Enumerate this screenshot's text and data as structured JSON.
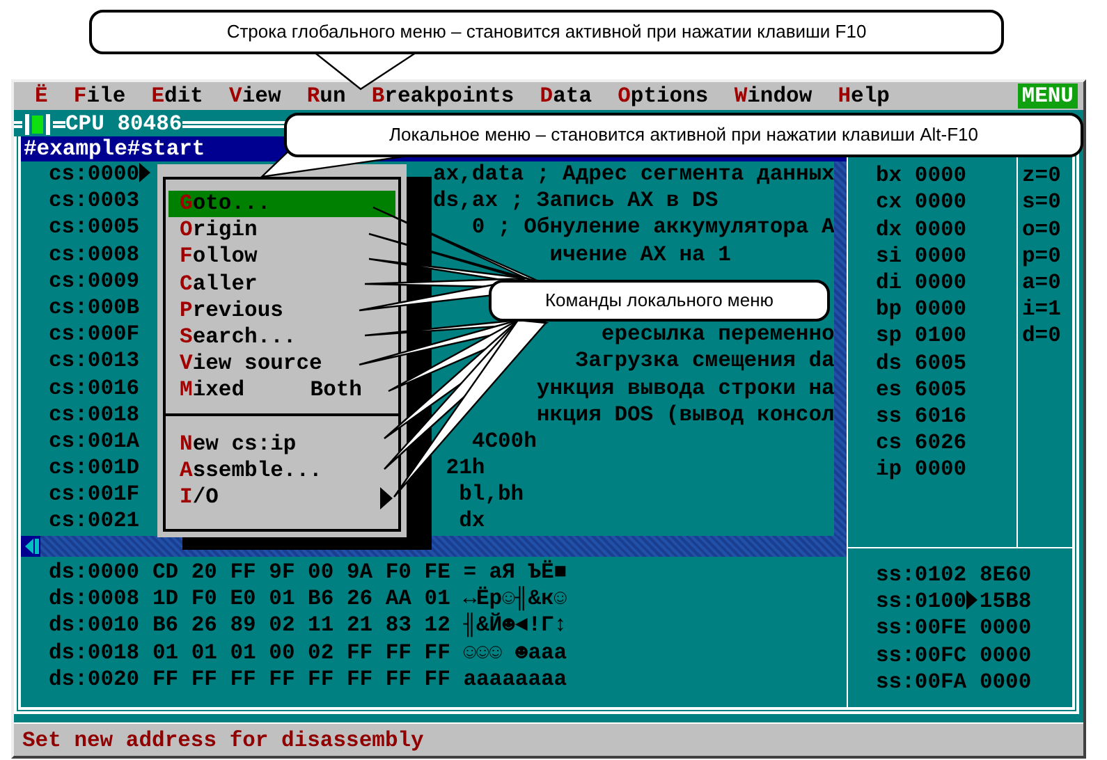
{
  "menu_bar": {
    "items": [
      {
        "hotkey": "Ё"
      },
      {
        "hotkey": "F",
        "rest": "ile"
      },
      {
        "hotkey": "E",
        "rest": "dit"
      },
      {
        "hotkey": "V",
        "rest": "iew"
      },
      {
        "hotkey": "R",
        "rest": "un"
      },
      {
        "hotkey": "B",
        "rest": "reakpoints"
      },
      {
        "hotkey": "D",
        "rest": "ata"
      },
      {
        "hotkey": "O",
        "rest": "ptions"
      },
      {
        "hotkey": "W",
        "rest": "indow"
      },
      {
        "hotkey": "H",
        "rest": "elp"
      }
    ],
    "indicator": "MENU"
  },
  "cpu_window": {
    "title": "CPU 80486",
    "source_header": "#example#start",
    "code_rows": [
      {
        "address": "cs:0000",
        "current": true,
        "code": "ax,data ; Адрес сегмента данных"
      },
      {
        "address": "cs:0003",
        "current": false,
        "code": "ds,ax ; Запись AX в DS"
      },
      {
        "address": "cs:0005",
        "current": false,
        "code": "0 ; Обнуление аккумулятора A"
      },
      {
        "address": "cs:0008",
        "current": false,
        "code": "ичение AX на 1"
      },
      {
        "address": "cs:0009",
        "current": false
      },
      {
        "address": "cs:000B",
        "current": false
      },
      {
        "address": "cs:000F",
        "current": false,
        "code": "ересылка переменно"
      },
      {
        "address": "cs:0013",
        "current": false,
        "code": "Загрузка смещения da"
      },
      {
        "address": "cs:0016",
        "current": false,
        "code": "ункция вывода строки на"
      },
      {
        "address": "cs:0018",
        "current": false,
        "code": "нкция DOS (вывод консол"
      },
      {
        "address": "cs:001A",
        "current": false,
        "code": "4C00h"
      },
      {
        "address": "cs:001D",
        "current": false,
        "code": "21h"
      },
      {
        "address": "cs:001F",
        "current": false,
        "code": "bl,bh"
      },
      {
        "address": "cs:0021",
        "current": false,
        "code": "dx"
      }
    ],
    "registers": [
      "bx 0000",
      "cx 0000",
      "dx 0000",
      "si 0000",
      "di 0000",
      "bp 0000",
      "sp 0100",
      "ds 6005",
      "es 6005",
      "ss 6016",
      "cs 6026",
      "ip 0000"
    ],
    "flags": [
      "z=0",
      "s=0",
      "o=0",
      "p=0",
      "a=0",
      "i=1",
      "d=0"
    ],
    "dump_rows": [
      {
        "address": "ds:0000",
        "bytes": "CD 20 FF 9F 00 9A F0 FE",
        "ascii": "= aЯ ЪЁ■"
      },
      {
        "address": "ds:0008",
        "bytes": "1D F0 E0 01 B6 26 AA 01",
        "ascii": "↔Ёр☺╢&к☺"
      },
      {
        "address": "ds:0010",
        "bytes": "B6 26 89 02 11 21 83 12",
        "ascii": "╢&Й☻◄!Г↕"
      },
      {
        "address": "ds:0018",
        "bytes": "01 01 01 00 02 FF FF FF",
        "ascii": "☺☺☺ ☻aaa"
      },
      {
        "address": "ds:0020",
        "bytes": "FF FF FF FF FF FF FF FF",
        "ascii": "aaaaaaaa"
      }
    ],
    "stack_rows": [
      {
        "address": "ss:0102",
        "value": "8E60",
        "current": false
      },
      {
        "address": "ss:0100",
        "value": "15B8",
        "current": true
      },
      {
        "address": "ss:00FE",
        "value": "0000",
        "current": false
      },
      {
        "address": "ss:00FC",
        "value": "0000",
        "current": false
      },
      {
        "address": "ss:00FA",
        "value": "0000",
        "current": false
      }
    ]
  },
  "local_menu": {
    "items": [
      {
        "kind": "item",
        "hotkey": "G",
        "rest": "oto...",
        "selected": true
      },
      {
        "kind": "item",
        "hotkey": "O",
        "rest": "rigin",
        "selected": false
      },
      {
        "kind": "item",
        "hotkey": "F",
        "rest": "ollow",
        "selected": false
      },
      {
        "kind": "item",
        "hotkey": "C",
        "rest": "aller",
        "selected": false
      },
      {
        "kind": "item",
        "hotkey": "P",
        "rest": "revious",
        "selected": false
      },
      {
        "kind": "item",
        "hotkey": "S",
        "rest": "earch...",
        "selected": false
      },
      {
        "kind": "item",
        "hotkey": "V",
        "rest": "iew source",
        "selected": false
      },
      {
        "kind": "item",
        "hotkey": "M",
        "rest": "ixed",
        "value": "Both",
        "selected": false
      },
      {
        "kind": "separator"
      },
      {
        "kind": "item",
        "hotkey": "N",
        "rest": "ew cs:ip",
        "selected": false
      },
      {
        "kind": "item",
        "hotkey": "A",
        "rest": "ssemble...",
        "selected": false
      },
      {
        "kind": "submenu",
        "hotkey": "I",
        "rest": "/O",
        "selected": false
      }
    ]
  },
  "status_bar": "Set new address for disassembly",
  "callouts": [
    {
      "text": "Строка глобального меню – становится активной при нажатии клавиши F10"
    },
    {
      "text": "Локальное меню – становится активной при нажатии клавиши Alt-F10"
    },
    {
      "text": "Команды локального меню"
    }
  ]
}
